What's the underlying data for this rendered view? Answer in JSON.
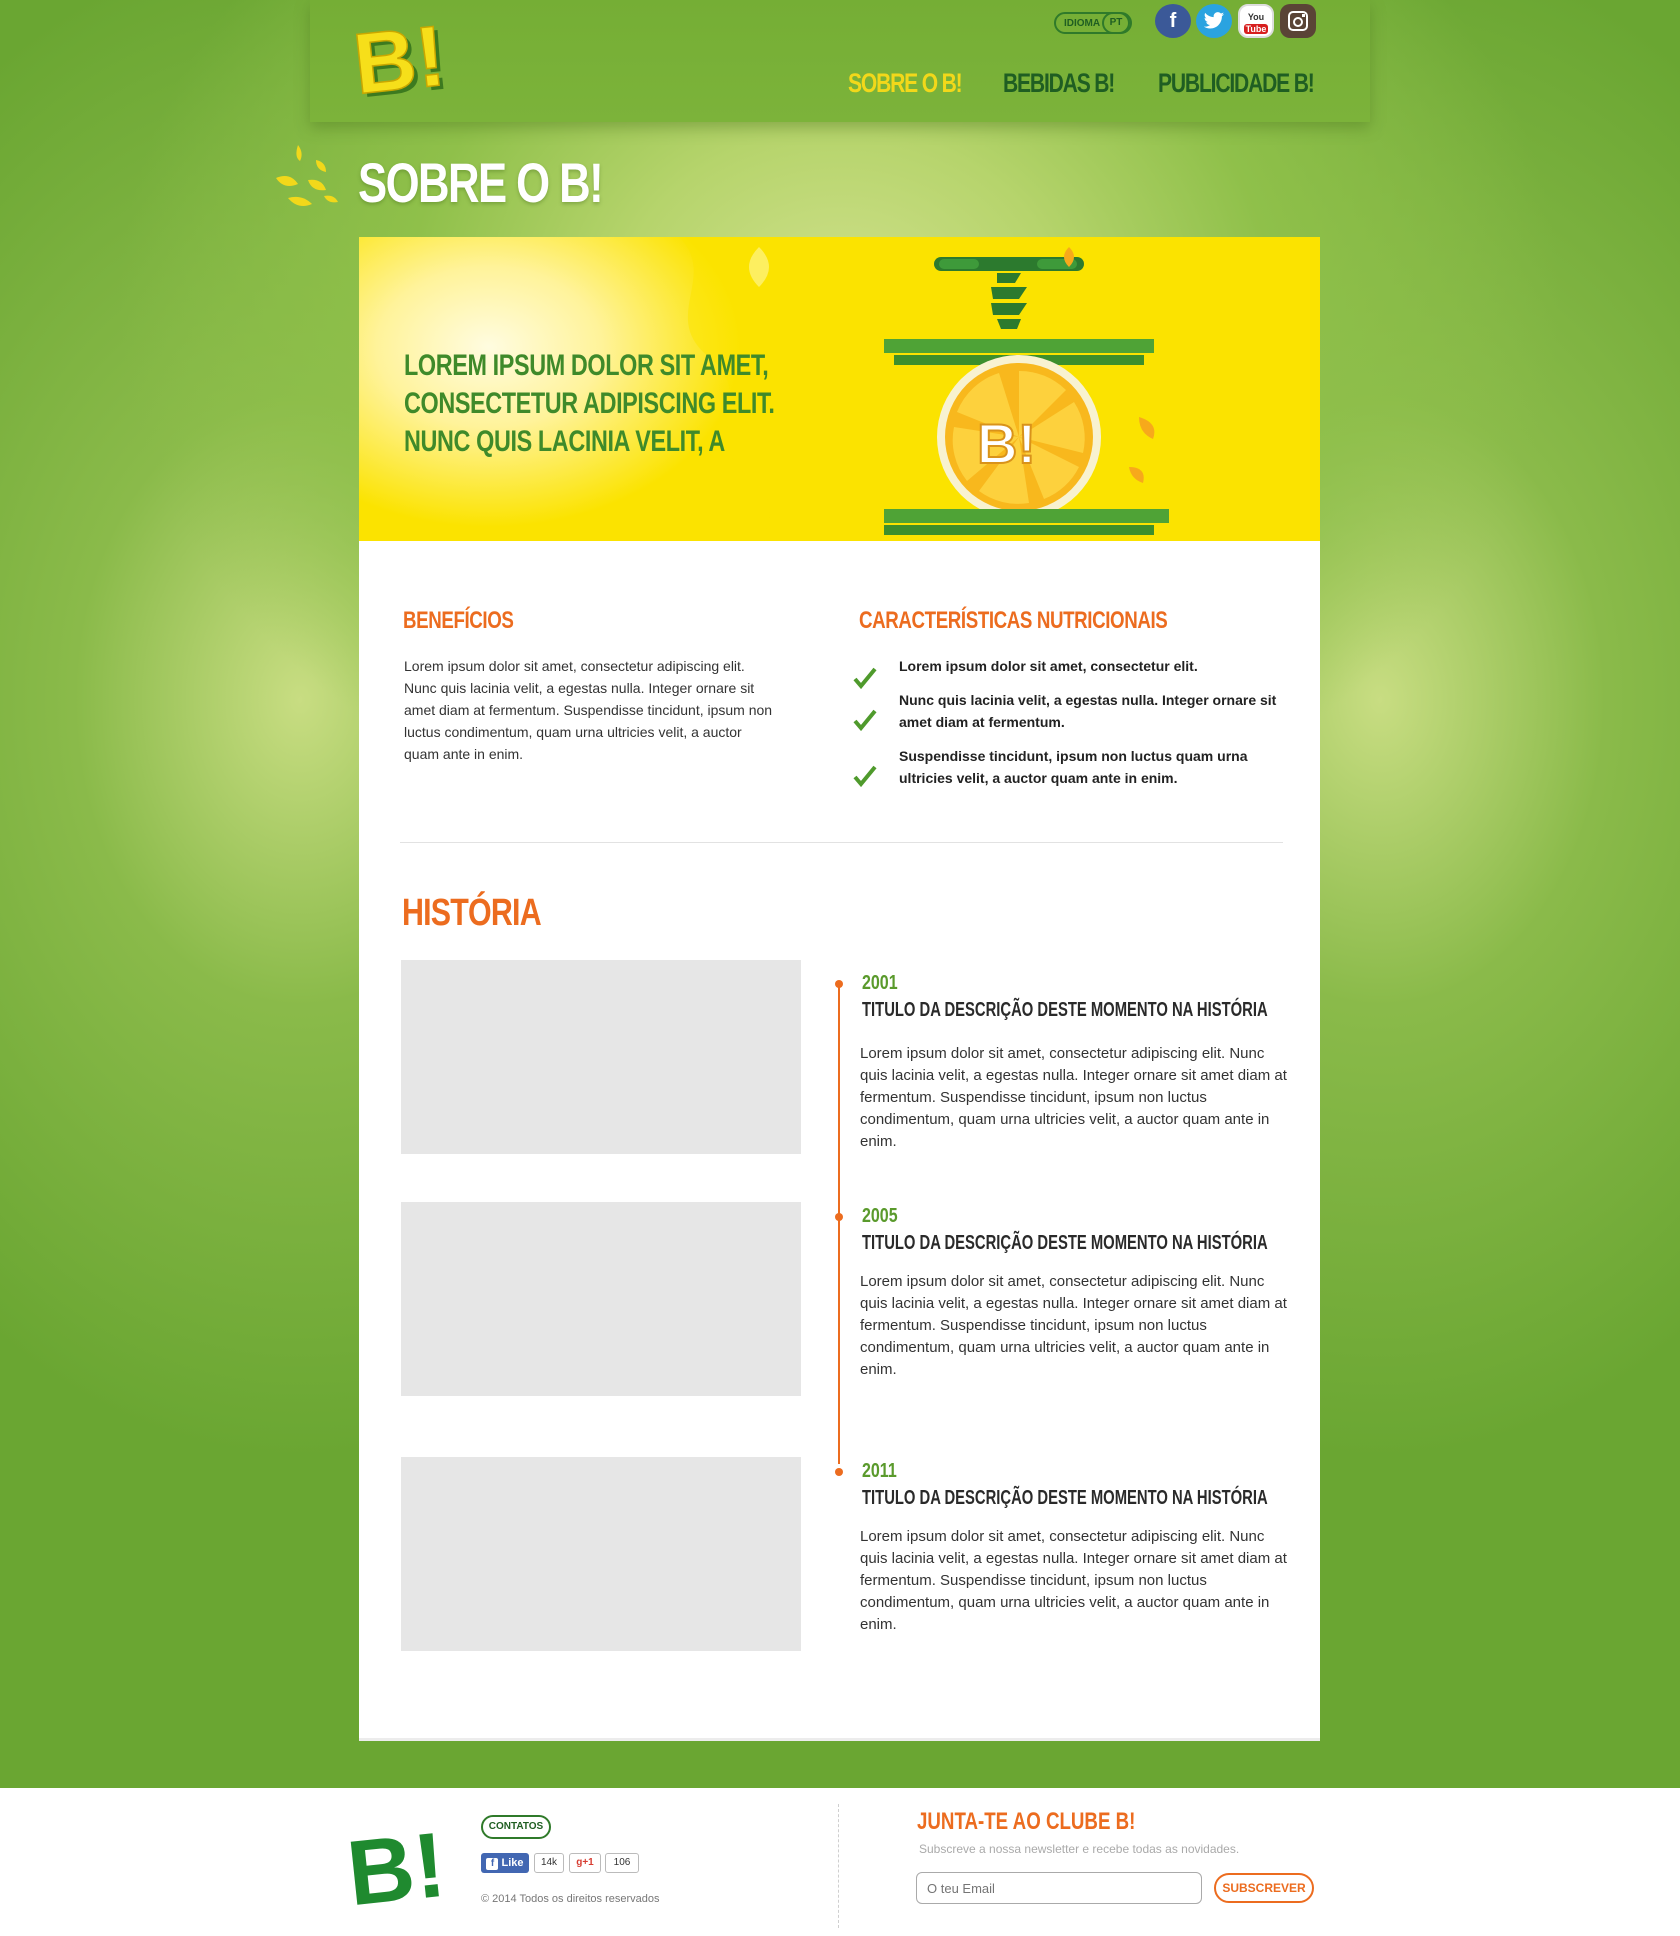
{
  "header": {
    "logo_text": "B!",
    "language_label": "IDIOMA",
    "language_value": "PT",
    "social": [
      {
        "name": "facebook",
        "glyph": "f",
        "color": "#3b5998"
      },
      {
        "name": "twitter",
        "glyph": "t",
        "color": "#2aa3e0"
      },
      {
        "name": "youtube",
        "glyph": "You Tube",
        "color": "#ffffff"
      },
      {
        "name": "instagram",
        "glyph": "◎",
        "color": "#5a4436"
      }
    ],
    "nav": [
      {
        "label": "SOBRE O B!",
        "active": true
      },
      {
        "label": "BEBIDAS B!",
        "active": false
      },
      {
        "label": "PUBLICIDADE B!",
        "active": false
      }
    ]
  },
  "page": {
    "title": "SOBRE O B!"
  },
  "hero": {
    "line1": "LOREM IPSUM DOLOR SIT AMET,",
    "line2": "CONSECTETUR ADIPISCING ELIT.",
    "line3": "NUNC QUIS LACINIA VELIT, A",
    "badge": "B!"
  },
  "beneficios": {
    "title": "BENEFÍCIOS",
    "text": "Lorem ipsum dolor sit amet, consectetur adipiscing elit. Nunc quis lacinia velit, a egestas nulla. Integer ornare sit amet diam at fermentum. Suspendisse tincidunt, ipsum non luctus condimentum, quam urna ultricies velit, a auctor quam ante in enim."
  },
  "caracteristicas": {
    "title": "CARACTERÍSTICAS NUTRICIONAIS",
    "items": [
      "Lorem ipsum dolor sit amet, consectetur  elit.",
      "Nunc quis lacinia velit, a egestas nulla. Integer ornare sit amet diam at fermentum.",
      "Suspendisse tincidunt, ipsum non luctus quam urna ultricies velit, a auctor quam ante in enim."
    ]
  },
  "historia": {
    "title": "HISTÓRIA",
    "entries": [
      {
        "year": "2001",
        "title": "TITULO DA DESCRIÇÃO DESTE MOMENTO NA HISTÓRIA",
        "text": "Lorem ipsum dolor sit amet, consectetur adipiscing elit. Nunc quis lacinia velit, a egestas nulla. Integer ornare sit amet diam at fermentum. Suspendisse tincidunt, ipsum non luctus condimentum, quam urna ultricies velit, a auctor quam ante in enim."
      },
      {
        "year": "2005",
        "title": "TITULO DA DESCRIÇÃO DESTE MOMENTO NA HISTÓRIA",
        "text": "Lorem ipsum dolor sit amet, consectetur adipiscing elit. Nunc quis lacinia velit, a egestas nulla. Integer ornare sit amet diam at fermentum. Suspendisse tincidunt, ipsum non luctus condimentum, quam urna ultricies velit, a auctor quam ante in enim."
      },
      {
        "year": "2011",
        "title": "TITULO DA DESCRIÇÃO DESTE MOMENTO NA HISTÓRIA",
        "text": "Lorem ipsum dolor sit amet, consectetur adipiscing elit. Nunc quis lacinia velit, a egestas nulla. Integer ornare sit amet diam at fermentum. Suspendisse tincidunt, ipsum non luctus condimentum, quam urna ultricies velit, a auctor quam ante in enim."
      }
    ]
  },
  "footer": {
    "logo_text": "B!",
    "contacts_label": "CONTATOS",
    "fb_like_label": "Like",
    "fb_count": "14k",
    "gplus_label": "+1",
    "gplus_count": "106",
    "copyright": "© 2014 Todos os direitos reservados",
    "club_title": "JUNTA-TE AO CLUBE B!",
    "club_subtitle": "Subscreve a nossa newsletter e recebe todas as novidades.",
    "email_placeholder": "O teu Email",
    "subscribe_label": "SUBSCREVER"
  },
  "colors": {
    "brand_green": "#6aa632",
    "dark_green": "#1f5e22",
    "accent_orange": "#ec6c1f",
    "brand_yellow": "#fbe300"
  }
}
